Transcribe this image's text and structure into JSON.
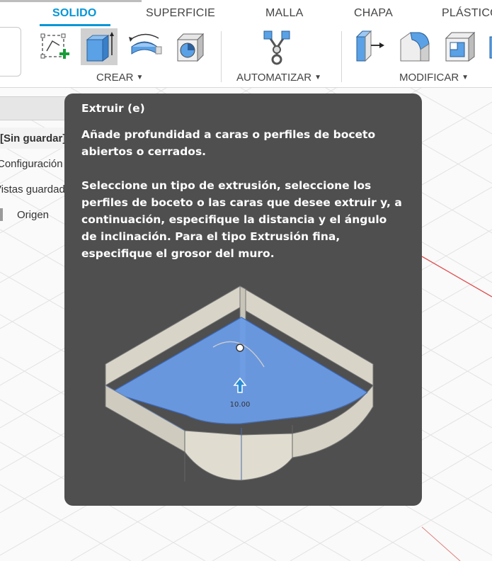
{
  "toolbar": {
    "tabs": [
      "SOLIDO",
      "SUPERFICIE",
      "MALLA",
      "CHAPA",
      "PLÁSTICO"
    ],
    "active_tab": "SOLIDO",
    "groups": {
      "crear": "CREAR",
      "automatizar": "AUTOMATIZAR",
      "modificar": "MODIFICAR"
    }
  },
  "browser": {
    "document": "[Sin guardar]",
    "row2": "Configuración del documento",
    "row3": "Vistas guardadas",
    "row4": "Origen"
  },
  "tooltip": {
    "title": "Extruir (e)",
    "description": "Añade profundidad a caras o perfiles de boceto abiertos o cerrados.",
    "detail": "Seleccione un tipo de extrusión, seleccione los perfiles de boceto o las caras que desee extruir y, a continuación, especifique la distancia y el ángulo de inclinación. Para el tipo Extrusión fina, especifique el grosor del muro.",
    "dimension_value": "10.00"
  },
  "colors": {
    "accent": "#0696d7",
    "tooltip_bg": "#4f4f4f",
    "extrude_blue": "#6b9be6"
  }
}
